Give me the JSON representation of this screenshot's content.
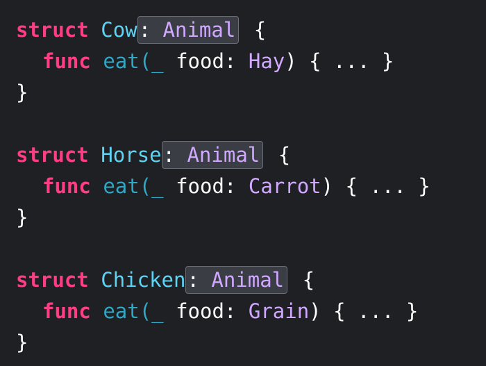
{
  "code": {
    "kw_struct": "struct",
    "kw_func": "func",
    "fn_name": "eat",
    "params_prefix": "(_ food: ",
    "params_suffix": ") { ... }",
    "open_brace": " {",
    "close_brace": "}",
    "conformance_colon": ":",
    "conformance_type": " Animal",
    "blocks": [
      {
        "type_name": "Cow",
        "food": "Hay"
      },
      {
        "type_name": "Horse",
        "food": "Carrot"
      },
      {
        "type_name": "Chicken",
        "food": "Grain"
      }
    ]
  },
  "colors": {
    "background": "#1f2023",
    "keyword": "#ff3d84",
    "type_declaration": "#5ed4f4",
    "function_name": "#2fa7c6",
    "type_reference": "#d0a8ff",
    "plain": "#ffffff",
    "highlight_fill": "#3a3d44",
    "highlight_border": "#6b6f78"
  }
}
